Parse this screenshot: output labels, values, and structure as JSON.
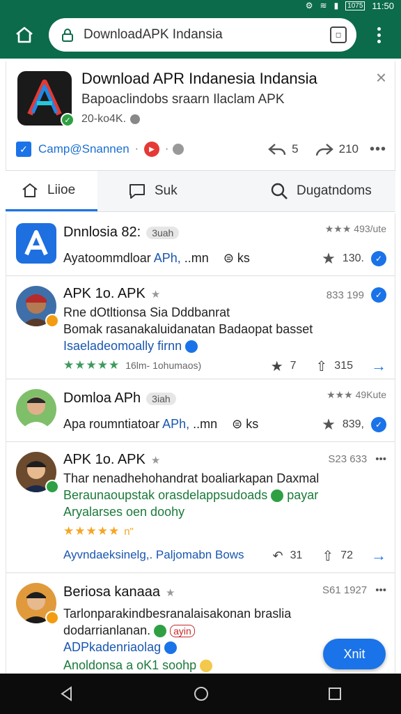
{
  "status_bar": {
    "battery": "1075",
    "time": "11:50"
  },
  "browser": {
    "url": "DownloadAPK Indansia"
  },
  "app_header": {
    "title": "Download APR Indanesia Indansia",
    "subtitle": "Bapoaclindobs sraarn Ilaclam APK",
    "meta": "20-ko4K.",
    "campaign": "Camp@Snannen",
    "share_count": "5",
    "forward_count": "210",
    "accent": "#0b6b4b"
  },
  "tabs": [
    {
      "label": "Liioe",
      "icon": "home-icon"
    },
    {
      "label": "Suk",
      "icon": "chat-icon"
    },
    {
      "label": "Dugatndoms",
      "icon": "search-icon"
    }
  ],
  "feed": [
    {
      "title": "Dnnlosia 82:",
      "pill": "3uah",
      "right": "★★★ 493/ute",
      "line1_a": "Ayatoommdloar ",
      "line1_b": "APh,",
      "line1_c": " ..mn",
      "line1_d": "ks",
      "stat": "130."
    },
    {
      "title": "APK 1o. APK",
      "right": "833 199",
      "line1": "Rne dOtltionsa Sia Dddbanrat",
      "line2": "Bomak rasanakaluidanatan Badaopat basset",
      "line3": "Isaeladeomoally firnn",
      "rating_text": "16lm- 1ohumaos)",
      "share": "7",
      "like": "315"
    },
    {
      "title": "Domloa APh",
      "pill": "3iah",
      "right": "★★★ 49Kute",
      "line1_a": "Apa roumntiatoar ",
      "line1_b": "APh,",
      "line1_c": " ..mn",
      "line1_d": "ks",
      "stat": "839,"
    },
    {
      "title": "APK 1o. APK",
      "right": "S23 633",
      "line1": "Thar nenadhehohandrat boaliarkapan Daxmal",
      "line2": "Beraunaoupstak orasdelappsudoads",
      "line2_tail": "payar",
      "line3": "Aryalarses oen doohy",
      "rating_text": "n\"",
      "footer": "Ayvndaeksinelg,. Paljomabn Bows",
      "share": "31",
      "like": "72"
    },
    {
      "title": "Beriosa kanaaa",
      "right": "S61 1927",
      "line1": "Tarlonparakindbesranalaisakonan braslia",
      "line2": "dodarrianlanan.",
      "line2_pill": "ayin",
      "line3": "ADPkadenriaolag",
      "line4": "Anoldonsa a oK1 soohp"
    }
  ],
  "fab": {
    "label": "Xnit"
  }
}
